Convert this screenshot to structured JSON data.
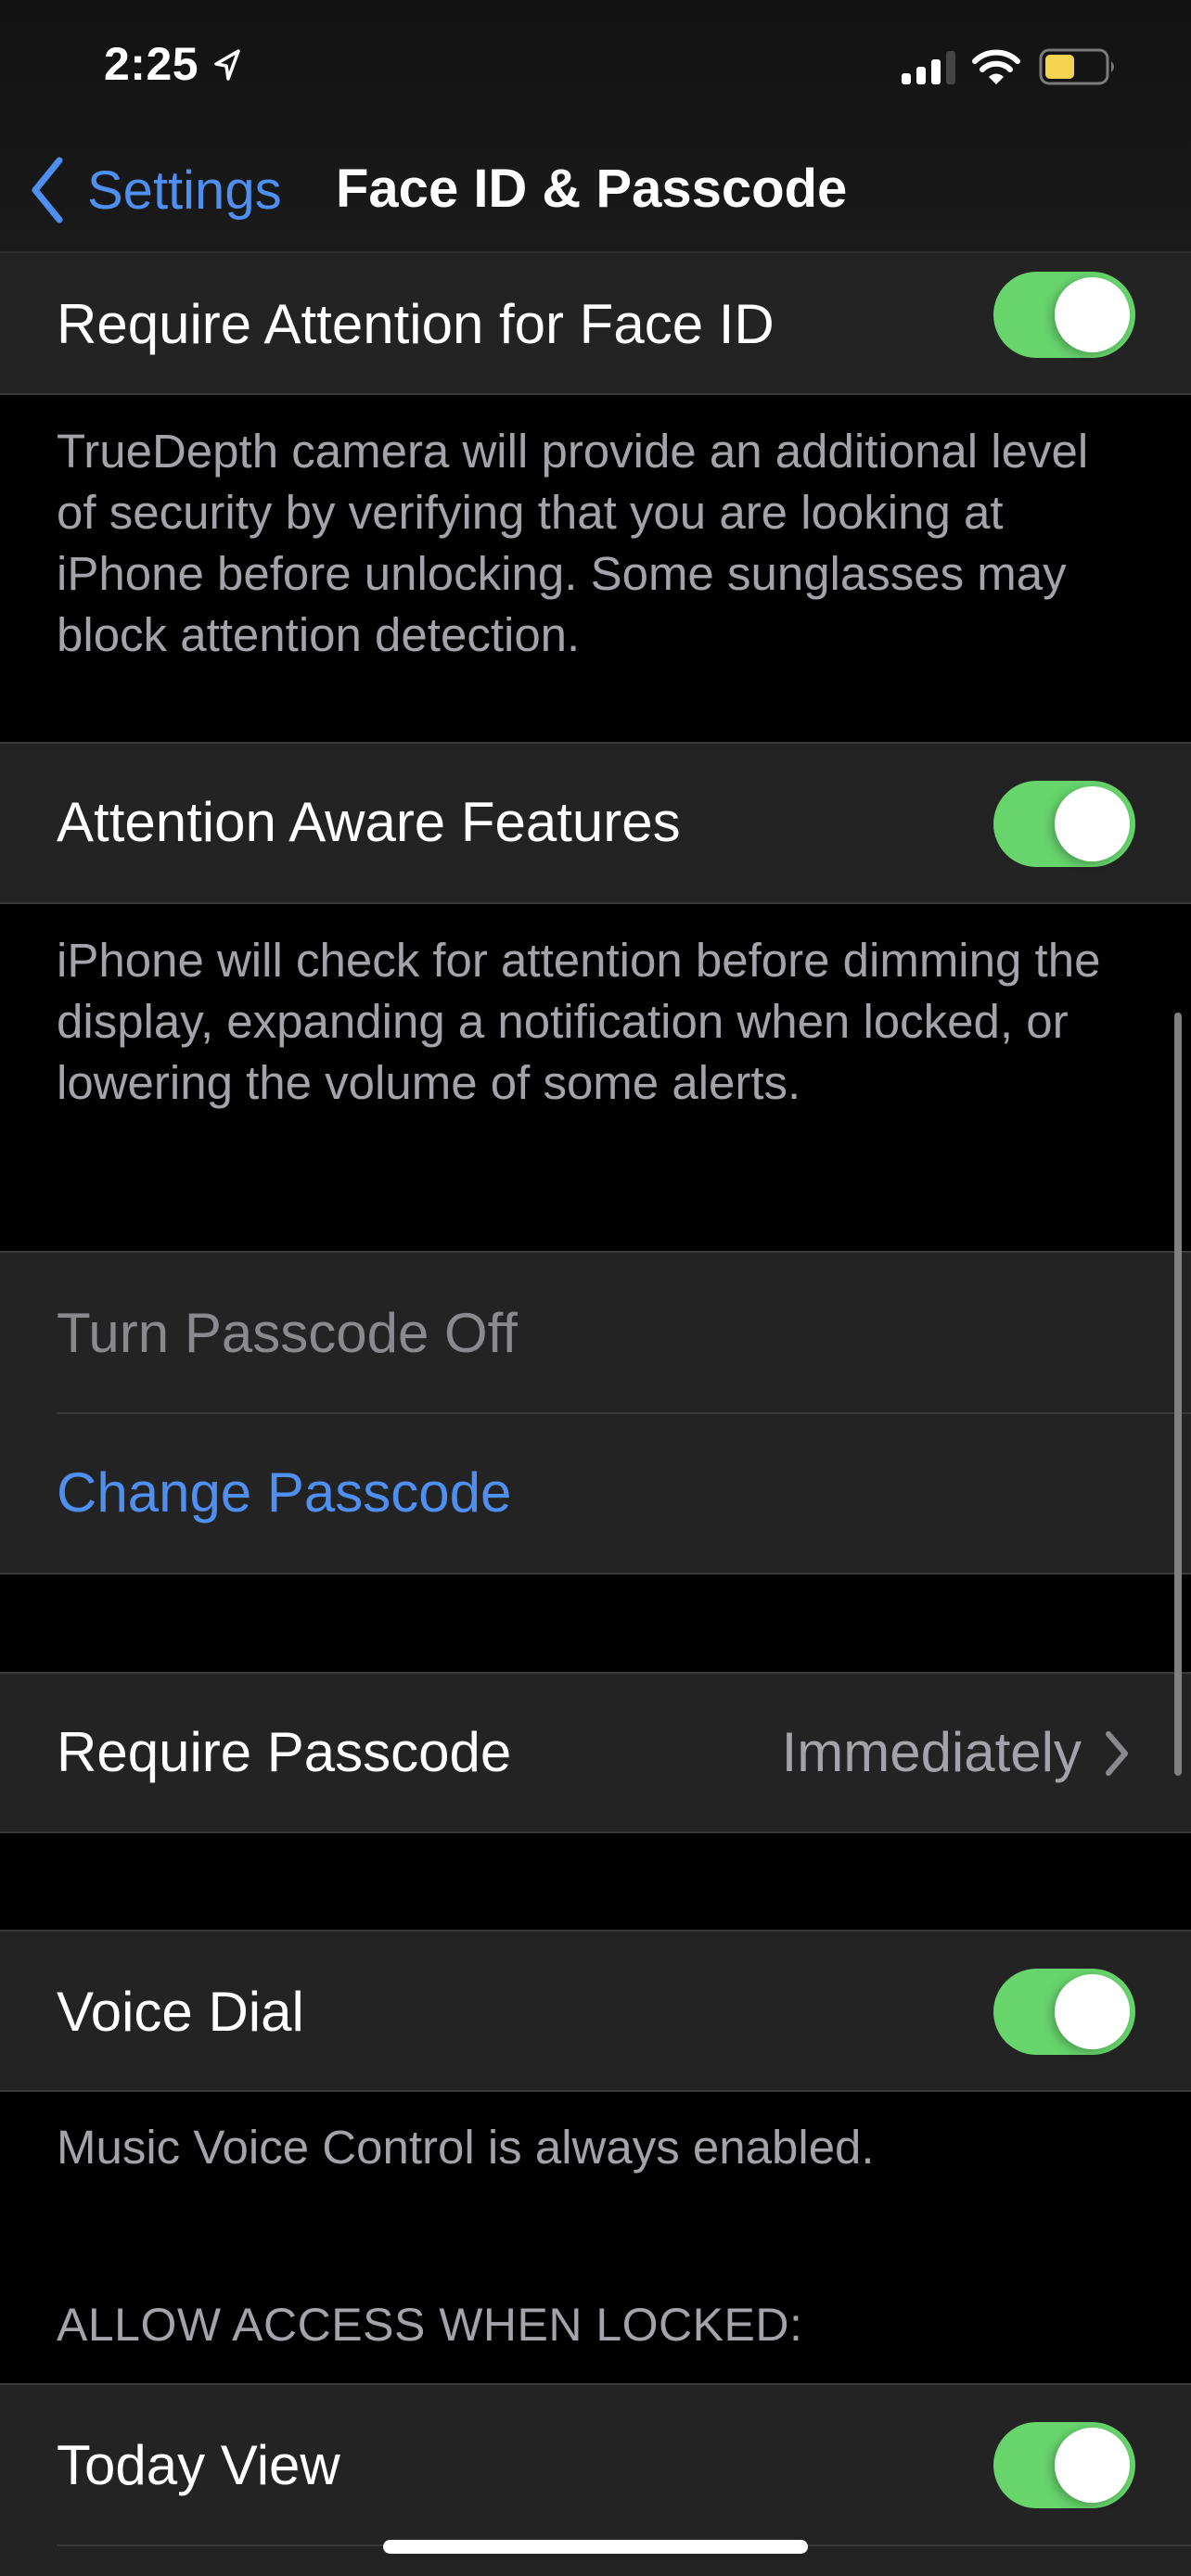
{
  "status_bar": {
    "time": "2:25",
    "location_icon": "location-arrow-icon",
    "signal_bars_filled": 3,
    "signal_bars_total": 4,
    "wifi_icon": "wifi-icon",
    "battery_level": 0.5,
    "battery_color": "#f5d24f",
    "low_power_mode": true
  },
  "nav": {
    "back_label": "Settings",
    "title": "Face ID & Passcode",
    "accent": "#4f8ff0"
  },
  "rows": {
    "require_attention": {
      "label": "Require Attention for Face ID",
      "on": true,
      "footer": "TrueDepth camera will provide an additional level of security by verifying that you are looking at iPhone before unlocking. Some sunglasses may block attention detection."
    },
    "attention_aware": {
      "label": "Attention Aware Features",
      "on": true,
      "footer": "iPhone will check for attention before dimming the display, expanding a notification when locked, or lowering the volume of some alerts."
    },
    "turn_passcode_off": {
      "label": "Turn Passcode Off",
      "disabled": true
    },
    "change_passcode": {
      "label": "Change Passcode"
    },
    "require_passcode": {
      "label": "Require Passcode",
      "value": "Immediately"
    },
    "voice_dial": {
      "label": "Voice Dial",
      "on": true,
      "footer": "Music Voice Control is always enabled."
    },
    "allow_access_header": "ALLOW ACCESS WHEN LOCKED:",
    "today_view": {
      "label": "Today View",
      "on": true
    }
  },
  "colors": {
    "toggle_on": "#67d46c",
    "link_blue": "#4f8ff0",
    "disabled_text": "#8a8a8e",
    "secondary_text": "#a3a3a9",
    "cell_bg": "#232323"
  }
}
